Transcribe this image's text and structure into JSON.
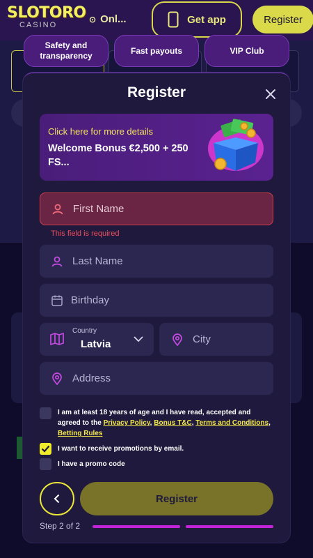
{
  "brand": {
    "name": "SLOTORO",
    "sub": "CASINO"
  },
  "topbar": {
    "online_label": "Onl...",
    "get_app_label": "Get app",
    "register_label": "Register"
  },
  "features": [
    {
      "label": "Safety and transparency"
    },
    {
      "label": "Fast payouts"
    },
    {
      "label": "VIP Club"
    }
  ],
  "modal": {
    "title": "Register",
    "bonus": {
      "link": "Click here for more details",
      "text": "Welcome Bonus €2,500 + 250 FS..."
    },
    "first_name": {
      "placeholder": "First Name",
      "error": "This field is required"
    },
    "last_name": {
      "placeholder": "Last Name"
    },
    "birthday": {
      "placeholder": "Birthday"
    },
    "country": {
      "label": "Country",
      "value": "Latvia"
    },
    "city": {
      "placeholder": "City"
    },
    "address": {
      "placeholder": "Address"
    },
    "consent": {
      "before": "I am at least 18 years of age and I have read, accepted and agreed to the ",
      "privacy": "Privacy Policy",
      "comma1": ", ",
      "bonus_tc": "Bonus T&C",
      "comma2": ", ",
      "terms": "Terms and Conditions",
      "comma3": ", ",
      "betting": "Betting Rules",
      "checked": false
    },
    "promo_email": {
      "label": "I want to receive promotions by email.",
      "checked": true
    },
    "promo_code": {
      "label": "I have a promo code",
      "checked": false
    },
    "submit_label": "Register",
    "step_label": "Step 2 of 2",
    "step_progress": 1.0
  },
  "colors": {
    "accent": "#f0ec2c",
    "purple": "#c424d8",
    "error": "#f04e5c",
    "modal_bg": "#1f1a3d"
  }
}
